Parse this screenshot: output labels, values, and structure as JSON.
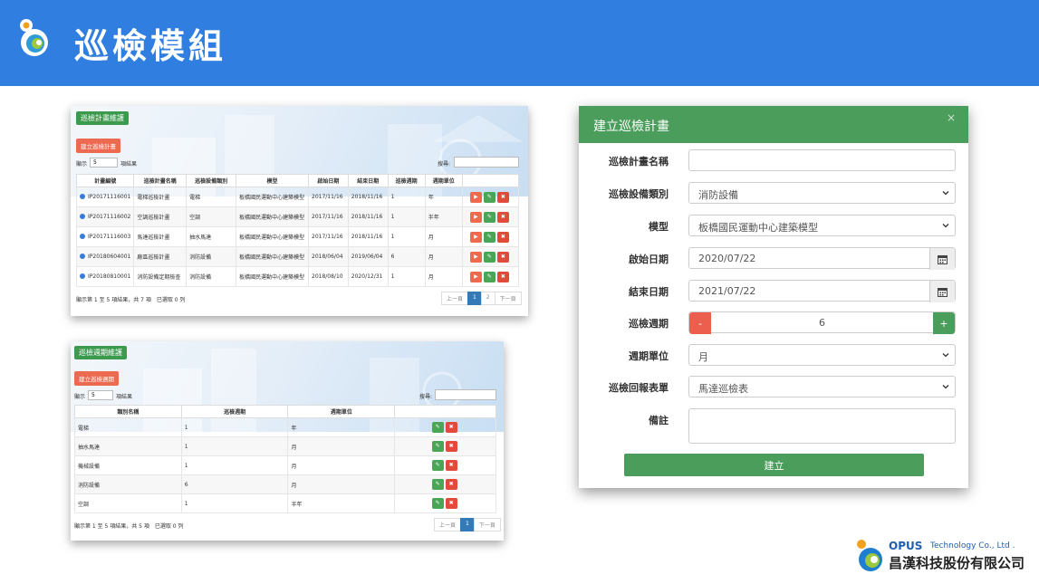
{
  "banner": {
    "title": "巡檢模組"
  },
  "plan_panel": {
    "tag": "巡檢計畫維護",
    "create_button": "建立巡檢計畫",
    "length_prefix": "顯示",
    "length_value": "5",
    "length_suffix": "項結果",
    "search_label": "搜尋:",
    "headers": [
      "計畫編號",
      "巡檢計畫名稱",
      "巡檢設備類別",
      "模型",
      "啟始日期",
      "結束日期",
      "巡檢週期",
      "週期單位",
      ""
    ],
    "rows": [
      [
        "IP20171116001",
        "電梯巡檢計畫",
        "電梯",
        "板橋國民運動中心建築模型",
        "2017/11/16",
        "2018/11/16",
        "1",
        "年"
      ],
      [
        "IP20171116002",
        "空調巡檢計畫",
        "空調",
        "板橋國民運動中心建築模型",
        "2017/11/16",
        "2018/11/16",
        "1",
        "半年"
      ],
      [
        "IP20171116003",
        "馬達巡檢計畫",
        "抽水馬達",
        "板橋國民運動中心建築模型",
        "2017/11/16",
        "2018/11/16",
        "1",
        "月"
      ],
      [
        "IP20180604001",
        "廠區巡檢計畫",
        "消防設備",
        "板橋國民運動中心建築模型",
        "2018/06/04",
        "2019/06/04",
        "6",
        "月"
      ],
      [
        "IP20180810001",
        "消防設備定期檢查",
        "消防設備",
        "板橋國民運動中心建築模型",
        "2018/08/10",
        "2020/12/31",
        "1",
        "月"
      ]
    ],
    "footer_info": "顯示第 1 至 5 項結果，共 7 項　已選取 0 列",
    "pager": [
      "上一頁",
      "1",
      "2",
      "下一頁"
    ]
  },
  "cycle_panel": {
    "tag": "巡檢週期維護",
    "create_button": "建立巡檢週期",
    "length_prefix": "顯示",
    "length_value": "5",
    "length_suffix": "項結果",
    "search_label": "搜尋:",
    "headers": [
      "類別名稱",
      "巡檢週期",
      "週期單位",
      ""
    ],
    "rows": [
      [
        "電梯",
        "1",
        "年"
      ],
      [
        "抽水馬達",
        "1",
        "月"
      ],
      [
        "機械設備",
        "1",
        "月"
      ],
      [
        "消防設備",
        "6",
        "月"
      ],
      [
        "空調",
        "1",
        "半年"
      ]
    ],
    "footer_info": "顯示第 1 至 5 項結果，共 5 項　已選取 0 列",
    "pager": [
      "上一頁",
      "1",
      "下一頁"
    ]
  },
  "modal": {
    "title": "建立巡檢計畫",
    "close": "×",
    "fields": {
      "plan_name": {
        "label": "巡檢計畫名稱",
        "value": ""
      },
      "equipment_type": {
        "label": "巡檢設備類別",
        "value": "消防設備"
      },
      "model": {
        "label": "模型",
        "value": "板橋國民運動中心建築模型"
      },
      "start_date": {
        "label": "啟始日期",
        "value": "2020/07/22"
      },
      "end_date": {
        "label": "結束日期",
        "value": "2021/07/22"
      },
      "cycle": {
        "label": "巡檢週期",
        "value": "6",
        "minus": "-",
        "plus": "+"
      },
      "cycle_unit": {
        "label": "週期單位",
        "value": "月"
      },
      "report_form": {
        "label": "巡檢回報表單",
        "value": "馬達巡檢表"
      },
      "remark": {
        "label": "備註",
        "value": ""
      }
    },
    "submit": "建立"
  },
  "company": {
    "brand": "OPUS",
    "en_suffix": "Technology Co., Ltd .",
    "zh_name": "昌漢科技股份有限公司"
  },
  "colors": {
    "banner": "#2f7ee0",
    "green": "#4a9d5b",
    "accent_red": "#ec6a50"
  }
}
